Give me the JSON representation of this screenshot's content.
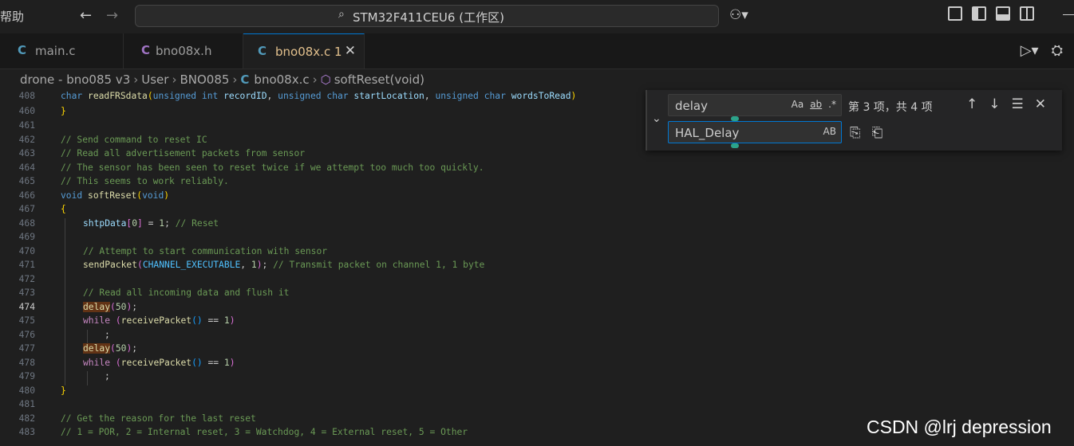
{
  "titlebar": {
    "menu_fragment": "帮助",
    "search_text": "STM32F411CEU6 (工作区)"
  },
  "tabs": [
    {
      "icon": "C",
      "label": "main.c",
      "active": false
    },
    {
      "icon": "C",
      "label": "bno08x.h",
      "active": false
    },
    {
      "icon": "C",
      "label": "bno08x.c",
      "badge": "1",
      "active": true
    }
  ],
  "breadcrumb": {
    "parts": [
      "drone - bno085 v3",
      "User",
      "BNO085",
      "bno08x.c",
      "softReset(void)"
    ]
  },
  "find_widget": {
    "find_value": "delay",
    "find_opts": [
      "Aa",
      "ab",
      ".*"
    ],
    "count": "第 3 项，共 4 项",
    "replace_value": "HAL_Delay",
    "replace_opt": "AB"
  },
  "editor": {
    "sticky_line_number": "408",
    "line_numbers": [
      "460",
      "461",
      "462",
      "463",
      "464",
      "465",
      "466",
      "467",
      "468",
      "469",
      "470",
      "471",
      "472",
      "473",
      "474",
      "475",
      "476",
      "477",
      "478",
      "479",
      "480",
      "481",
      "482",
      "483"
    ],
    "current_line": "474",
    "search_term": "delay"
  },
  "colors": {
    "accent": "#0078d4",
    "match_highlight": "#623315",
    "background": "#1f1f1f"
  },
  "watermark": "CSDN @lrj  depression"
}
